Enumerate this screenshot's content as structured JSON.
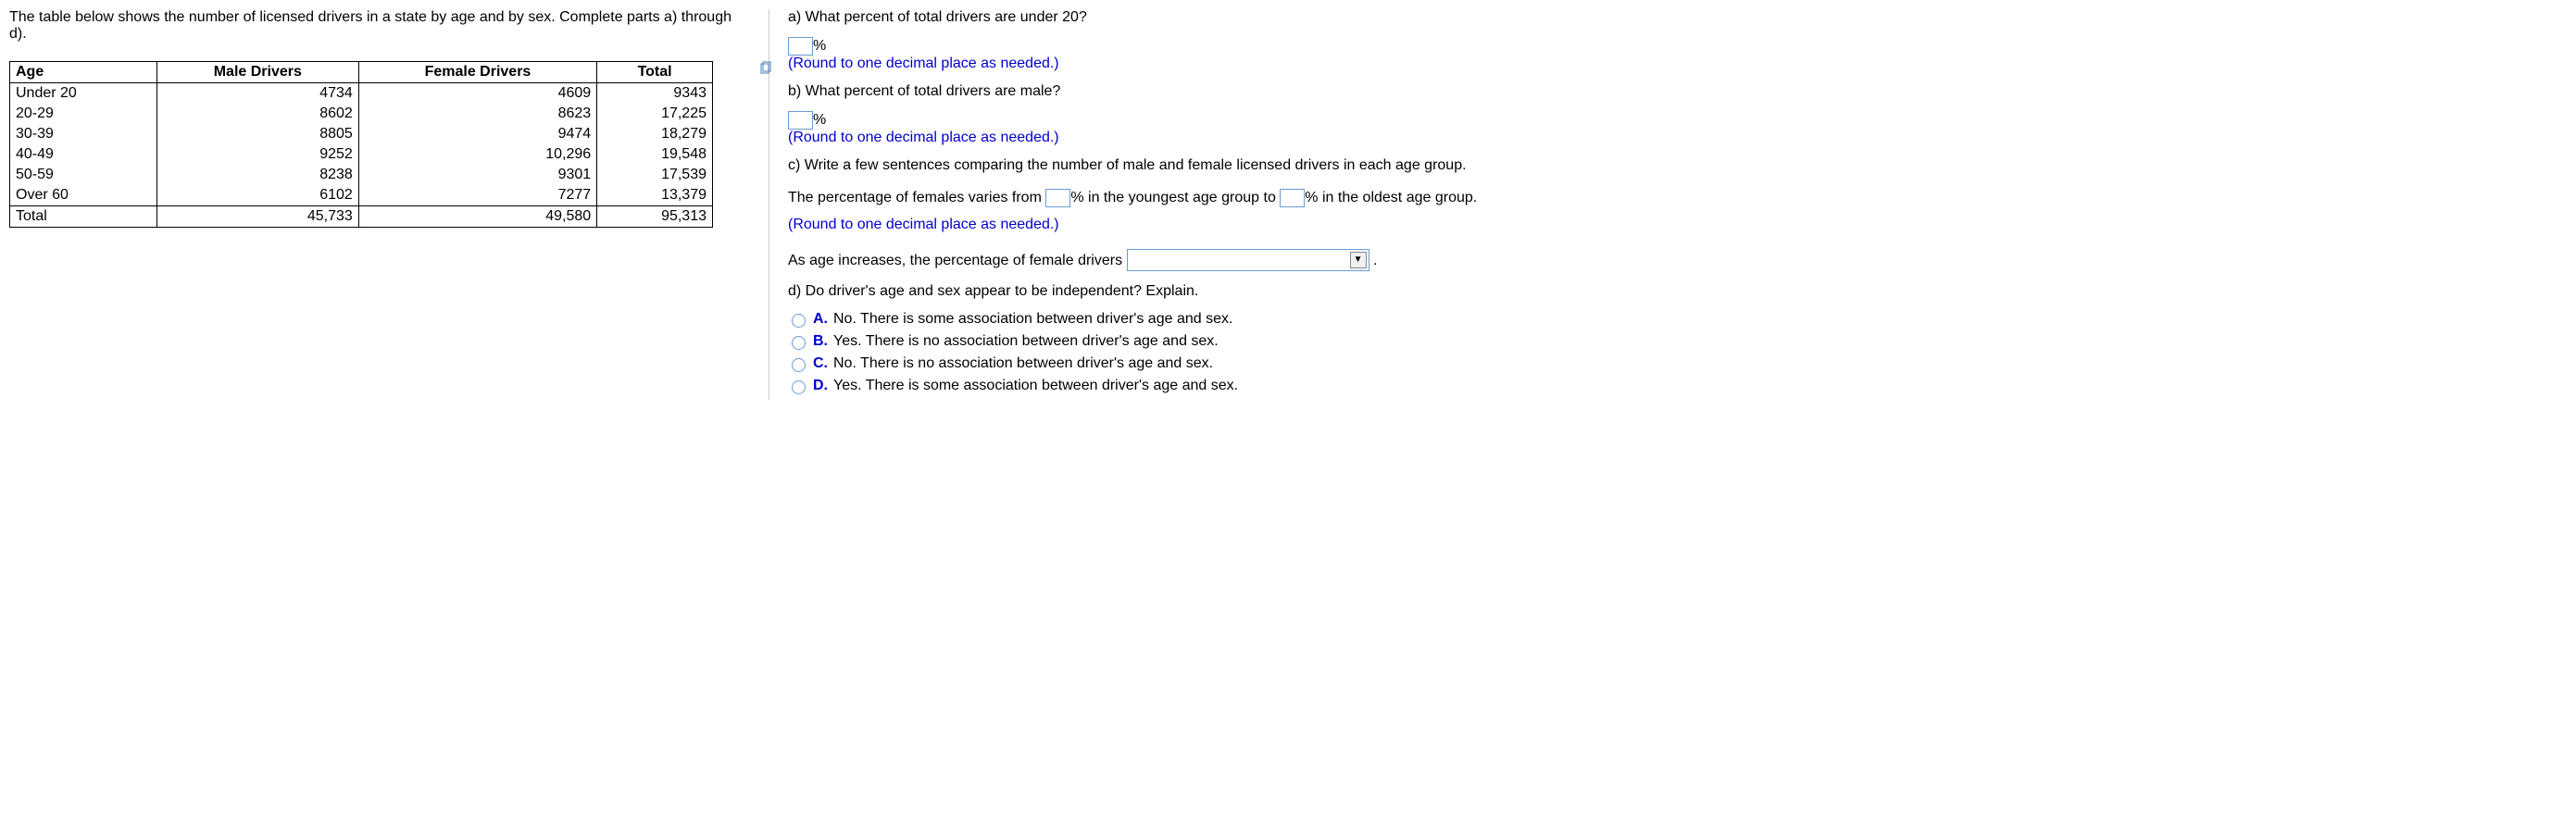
{
  "intro": "The table below shows the number of licensed drivers in a state by age and by sex. Complete parts a) through d).",
  "table": {
    "headers": {
      "age": "Age",
      "male": "Male Drivers",
      "female": "Female Drivers",
      "total": "Total"
    },
    "rows": [
      {
        "age": "Under 20",
        "male": "4734",
        "female": "4609",
        "total": "9343"
      },
      {
        "age": "20-29",
        "male": "8602",
        "female": "8623",
        "total": "17,225"
      },
      {
        "age": "30-39",
        "male": "8805",
        "female": "9474",
        "total": "18,279"
      },
      {
        "age": "40-49",
        "male": "9252",
        "female": "10,296",
        "total": "19,548"
      },
      {
        "age": "50-59",
        "male": "8238",
        "female": "9301",
        "total": "17,539"
      },
      {
        "age": "Over 60",
        "male": "6102",
        "female": "7277",
        "total": "13,379"
      },
      {
        "age": "Total",
        "male": "45,733",
        "female": "49,580",
        "total": "95,313"
      }
    ]
  },
  "qa": {
    "a_text": "a) What percent of total drivers are under 20?",
    "percent_symbol": "%",
    "round_note": "(Round to one decimal place as needed.)",
    "b_text": "b) What percent of total drivers are male?",
    "c_text": "c) Write a few sentences comparing the number of male and female licensed drivers in each age group.",
    "c_sentence_pre": "The percentage of females varies from ",
    "c_sentence_mid": "% in the youngest age group to ",
    "c_sentence_post": "% in the oldest age group.",
    "c_trend": "As age increases, the percentage of female drivers ",
    "period": ".",
    "d_text": "d) Do driver's age and sex appear to be independent? Explain.",
    "choices": [
      {
        "label": "A.",
        "text": "No. There is some association between driver's age and sex."
      },
      {
        "label": "B.",
        "text": "Yes. There is no association between driver's age and sex."
      },
      {
        "label": "C.",
        "text": "No. There is no association between driver's age and sex."
      },
      {
        "label": "D.",
        "text": "Yes. There is some association between driver's age and sex."
      }
    ]
  }
}
